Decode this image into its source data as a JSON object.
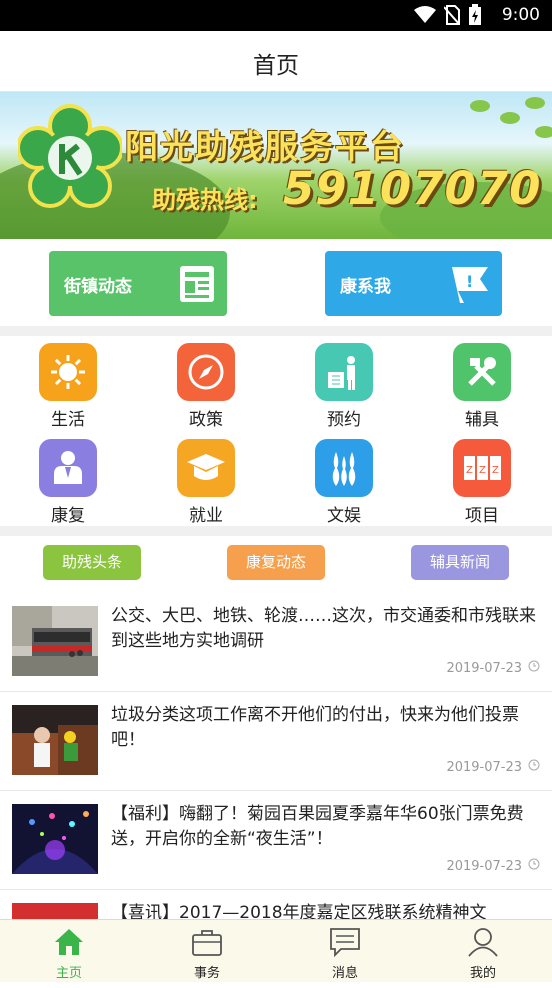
{
  "status_bar": {
    "time": "9:00"
  },
  "header": {
    "title": "首页"
  },
  "banner": {
    "title": "阳光助残服务平台",
    "hotline_label": "助残热线:",
    "hotline_number": "59107070"
  },
  "quick_buttons": [
    {
      "label": "街镇动态",
      "color": "#59c36a",
      "icon": "newspaper-icon"
    },
    {
      "label": "康系我",
      "color": "#2ea8e6",
      "icon": "flag-icon"
    }
  ],
  "grid": [
    {
      "label": "生活",
      "color": "#f7a21b",
      "icon": "sun-icon"
    },
    {
      "label": "政策",
      "color": "#f4643a",
      "icon": "compass-icon"
    },
    {
      "label": "预约",
      "color": "#46c8b2",
      "icon": "calendar-person-icon"
    },
    {
      "label": "辅具",
      "color": "#4fc46a",
      "icon": "tools-icon"
    },
    {
      "label": "康复",
      "color": "#8a7ee0",
      "icon": "doctor-icon"
    },
    {
      "label": "就业",
      "color": "#f5a623",
      "icon": "graduation-cap-icon"
    },
    {
      "label": "文娱",
      "color": "#2d9ee8",
      "icon": "bowling-icon"
    },
    {
      "label": "项目",
      "color": "#f55a3c",
      "icon": "blocks-icon"
    }
  ],
  "news_tabs": [
    {
      "label": "助残头条",
      "color": "#8bc53f"
    },
    {
      "label": "康复动态",
      "color": "#f6a04d"
    },
    {
      "label": "辅具新闻",
      "color": "#9a96e0"
    }
  ],
  "news": [
    {
      "title": "公交、大巴、地铁、轮渡……这次，市交通委和市残联来到这些地方实地调研",
      "date": "2019-07-23"
    },
    {
      "title": "垃圾分类这项工作离不开他们的付出，快来为他们投票吧！",
      "date": "2019-07-23"
    },
    {
      "title": "【福利】嗨翻了！菊园百果园夏季嘉年华60张门票免费送，开启你的全新“夜生活”！",
      "date": "2019-07-23"
    },
    {
      "title": "【喜讯】2017—2018年度嘉定区残联系统精神文",
      "date": ""
    }
  ],
  "bottom_nav": [
    {
      "label": "主页",
      "icon": "home-icon",
      "active": true
    },
    {
      "label": "事务",
      "icon": "briefcase-icon",
      "active": false
    },
    {
      "label": "消息",
      "icon": "message-icon",
      "active": false
    },
    {
      "label": "我的",
      "icon": "user-icon",
      "active": false
    }
  ]
}
